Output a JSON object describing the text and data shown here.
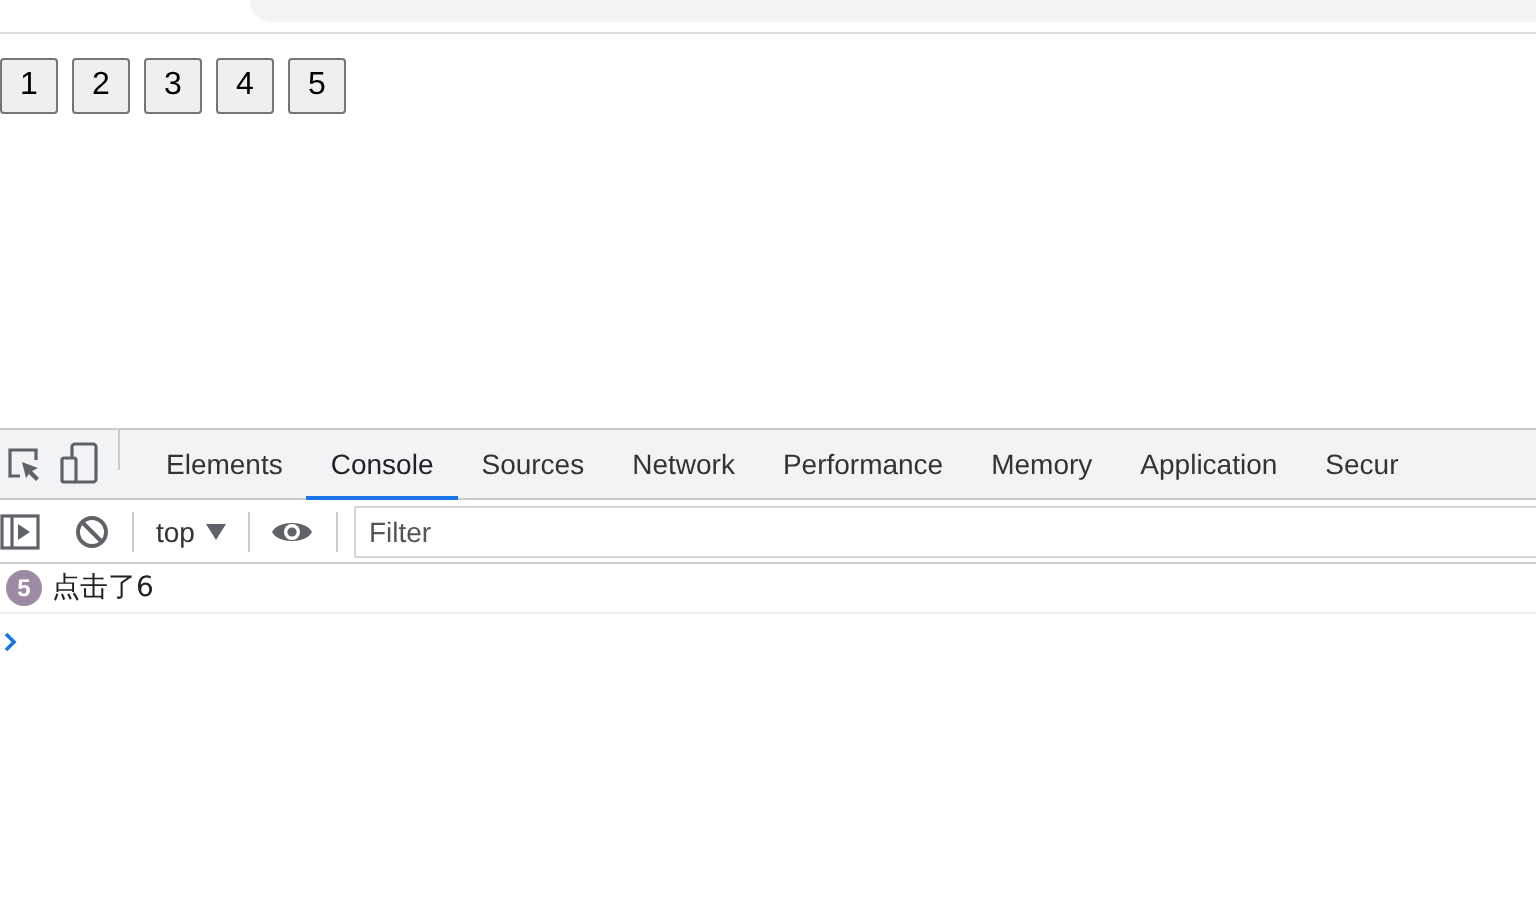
{
  "page": {
    "buttons": [
      "1",
      "2",
      "3",
      "4",
      "5"
    ]
  },
  "devtools": {
    "tabs": [
      {
        "label": "Elements",
        "selected": false
      },
      {
        "label": "Console",
        "selected": true
      },
      {
        "label": "Sources",
        "selected": false
      },
      {
        "label": "Network",
        "selected": false
      },
      {
        "label": "Performance",
        "selected": false
      },
      {
        "label": "Memory",
        "selected": false
      },
      {
        "label": "Application",
        "selected": false
      },
      {
        "label": "Secur",
        "selected": false
      }
    ],
    "console_toolbar": {
      "context": "top",
      "filter": {
        "placeholder": "Filter"
      }
    },
    "messages": [
      {
        "count": "5",
        "text": "点击了6"
      }
    ]
  }
}
